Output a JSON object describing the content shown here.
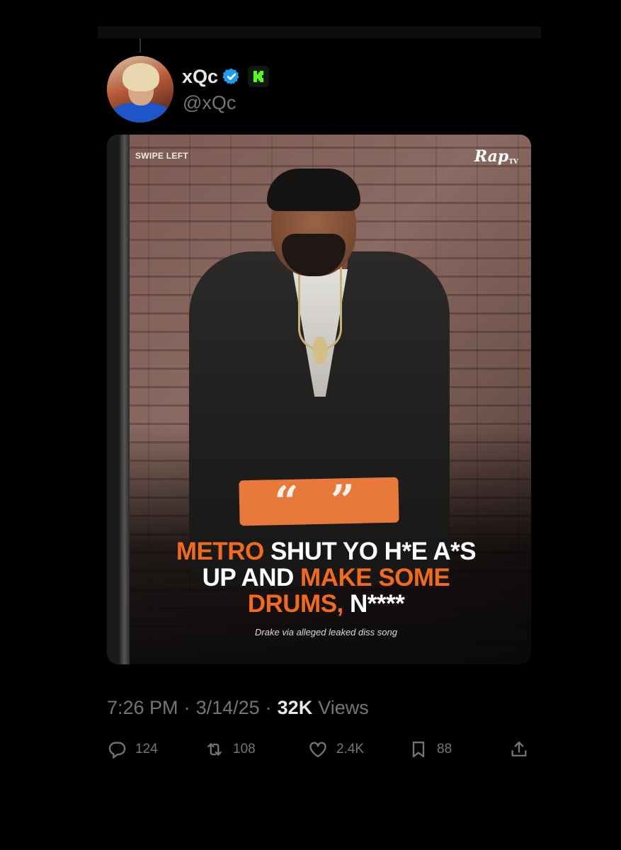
{
  "tweet": {
    "display_name": "xQc",
    "handle": "@xQc",
    "time": "7:26 PM",
    "date": "3/14/25",
    "views_count": "32K",
    "views_label": "Views"
  },
  "media": {
    "swipe_label": "SWIPE LEFT",
    "brand_logo": "Rap",
    "brand_logo_sub": "TV",
    "quote_marks": "“ ”",
    "headline": {
      "line1_highlight": "METRO",
      "line1_rest": " SHUT YO H*E A*S",
      "line2_plain": "UP AND ",
      "line2_highlight": "MAKE SOME",
      "line3_highlight": "DRUMS,",
      "line3_rest": " N****"
    },
    "caption": "Drake via alleged leaked diss song"
  },
  "actions": {
    "replies": "124",
    "reposts": "108",
    "likes": "2.4K",
    "bookmarks": "88"
  },
  "colors": {
    "background": "#000000",
    "accent_orange": "#f26a1b",
    "secondary_text": "#71767b",
    "verified_blue": "#1d9bf0",
    "kick_green": "#53fc18"
  }
}
